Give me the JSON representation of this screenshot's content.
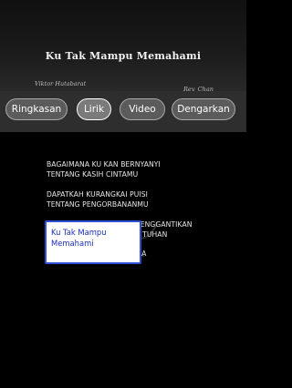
{
  "song": {
    "title": "Ku Tak Mampu Memahami",
    "author": "Viktor Hutabarat",
    "signature": "Rey_Chan"
  },
  "tabs": [
    {
      "label": "Ringkasan",
      "active": false
    },
    {
      "label": "Lirik",
      "active": true
    },
    {
      "label": "Video",
      "active": false
    },
    {
      "label": "Dengarkan",
      "active": false
    }
  ],
  "lyrics": {
    "lines": [
      "BAGAIMANA KU KAN BERNYANYI",
      "TENTANG KASIH CINTAMU",
      "",
      "DAPATKAH KURANGKAI PUISI",
      "TENTANG PENGORBANANMU",
      "",
      "BUDI MANA SEBANDING MENGGANTIKAN",
      "ANUGERAH-MU KEPADAKU TUHAN",
      "",
      "UNTUK AKU YANG BERDOSA"
    ]
  },
  "popup": {
    "text": "Ku Tak Mampu Memahami"
  },
  "colors": {
    "background": "#000000",
    "tab_bar": "#2e2e2e",
    "tab_fill": "#5b5b5b",
    "popup_border": "#2d4fd6",
    "popup_text": "#1a2fb8"
  }
}
